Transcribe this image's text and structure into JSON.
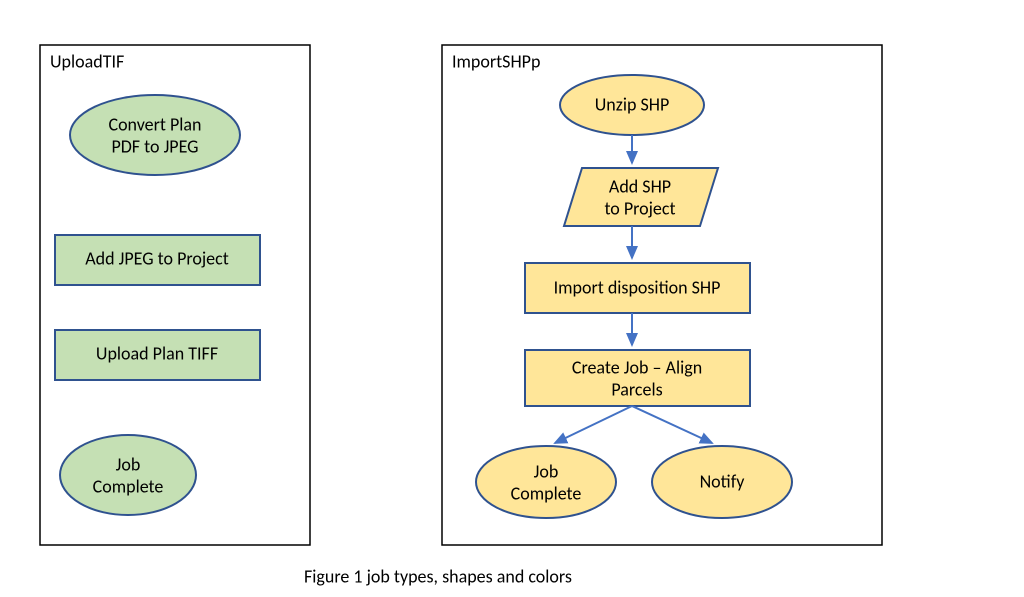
{
  "left": {
    "title": "UploadTIF",
    "nodes": {
      "convert": {
        "l1": "Convert Plan",
        "l2": "PDF to JPEG"
      },
      "addjpeg": {
        "l1": "Add JPEG to Project"
      },
      "upload": {
        "l1": "Upload Plan TIFF"
      },
      "done": {
        "l1": "Job",
        "l2": "Complete"
      }
    }
  },
  "right": {
    "title": "ImportSHPp",
    "nodes": {
      "unzip": {
        "l1": "Unzip SHP"
      },
      "addshp": {
        "l1": "Add SHP",
        "l2": "to Project"
      },
      "import": {
        "l1": "Import disposition SHP"
      },
      "create": {
        "l1": "Create Job – Align",
        "l2": "Parcels"
      },
      "done": {
        "l1": "Job",
        "l2": "Complete"
      },
      "notify": {
        "l1": "Notify"
      }
    }
  },
  "caption": "Figure 1 job types, shapes and colors"
}
